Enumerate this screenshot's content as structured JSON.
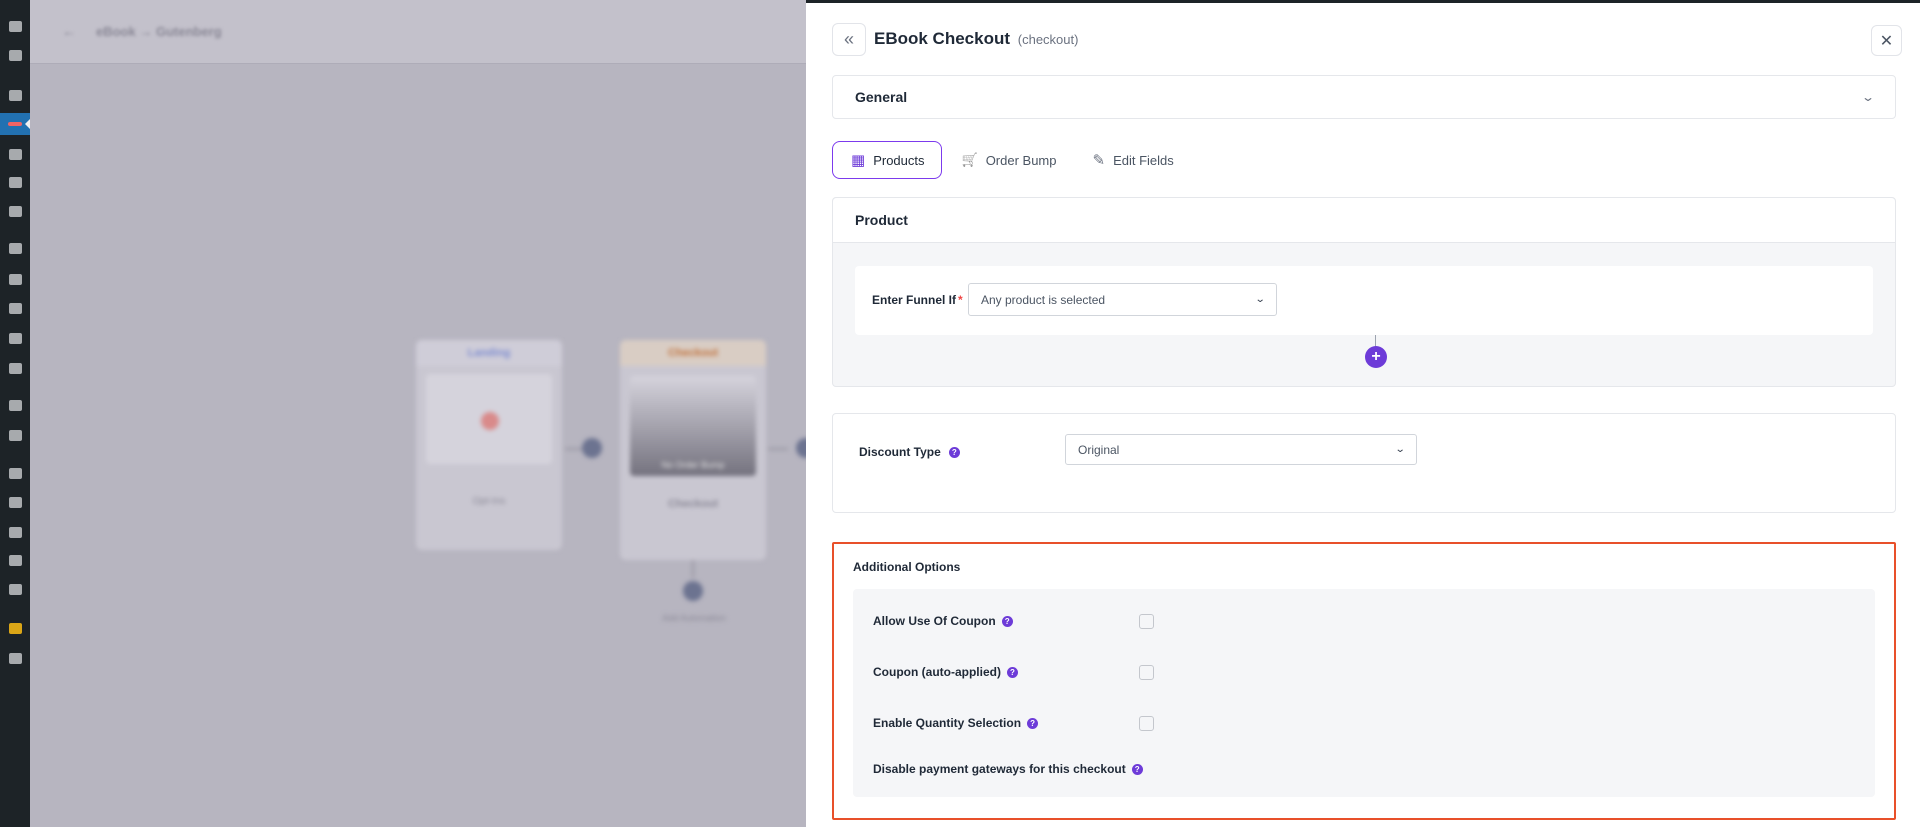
{
  "background": {
    "breadcrumb": "eBook → Gutenberg",
    "back_arrow": "←",
    "nodes": {
      "landing": {
        "header": "Landing",
        "caption": "Opt-Ins"
      },
      "checkout": {
        "header": "Checkout",
        "caption": "Checkout",
        "overlay": "No Order Bump"
      },
      "add_node_caption": "Add Automation"
    }
  },
  "panel": {
    "title": "EBook Checkout",
    "slug": "(checkout)",
    "back_icon": "«",
    "close_icon": "✕",
    "general": {
      "label": "General",
      "chevron": "⌄"
    },
    "tabs": [
      {
        "label": "Products",
        "icon": "grid-icon",
        "glyph": "▦",
        "active": true
      },
      {
        "label": "Order Bump",
        "icon": "cart-icon",
        "glyph": "🛒",
        "active": false
      },
      {
        "label": "Edit Fields",
        "icon": "pencil-icon",
        "glyph": "✎",
        "active": false
      }
    ],
    "product": {
      "heading": "Product",
      "funnel_label": "Enter Funnel If",
      "required_mark": "*",
      "condition_select": "Any product is selected",
      "add_icon": "+"
    },
    "discount": {
      "label": "Discount Type",
      "help": "?",
      "select_value": "Original"
    },
    "additional": {
      "title": "Additional Options",
      "options": [
        {
          "label": "Allow Use Of Coupon",
          "help": "?",
          "checked": false,
          "has_checkbox": true
        },
        {
          "label": "Coupon (auto-applied)",
          "help": "?",
          "checked": false,
          "has_checkbox": true
        },
        {
          "label": "Enable Quantity Selection",
          "help": "?",
          "checked": false,
          "has_checkbox": true
        },
        {
          "label": "Disable payment gateways for this checkout",
          "help": "?",
          "has_checkbox": false
        }
      ]
    }
  },
  "colors": {
    "accent": "#6d3bd8",
    "highlight_border": "#e8502a",
    "wp_sidebar": "#1d2327",
    "wp_active": "#2271b1"
  },
  "wp_sidebar_icons": [
    "dashboard-icon",
    "mail-icon",
    "pin-icon",
    "funnel-icon",
    "media-icon",
    "pages-icon",
    "comments-icon",
    "woo-icon",
    "archive-icon",
    "dollar-icon",
    "analytics-icon",
    "megaphone-icon",
    "elementor-icon",
    "folder-icon",
    "appearance-icon",
    "plugins-icon",
    "users-icon",
    "tools-icon",
    "settings-icon",
    "portfolio-icon",
    "play-icon"
  ]
}
